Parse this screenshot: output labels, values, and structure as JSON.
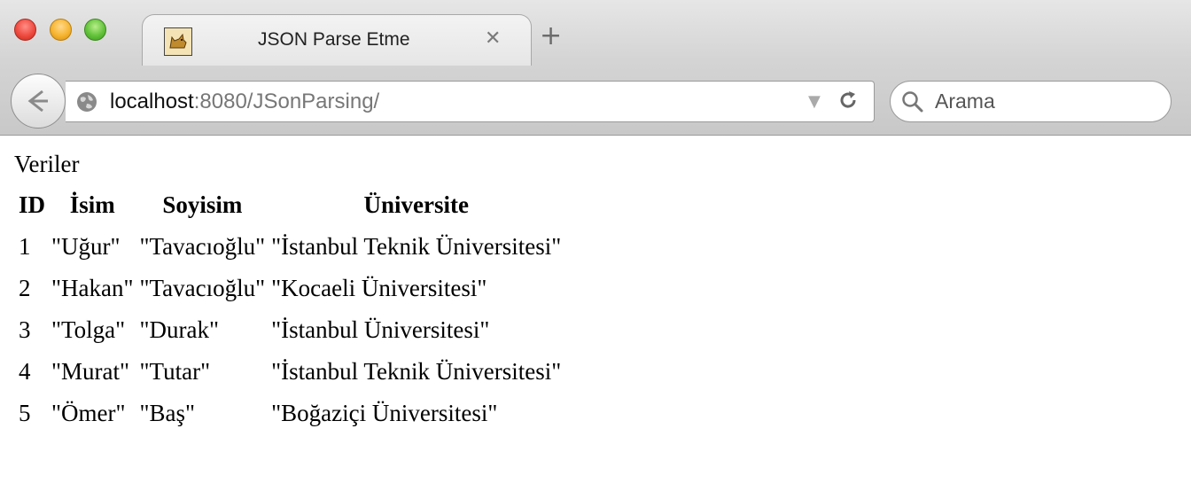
{
  "browser": {
    "tab_title": "JSON Parse Etme",
    "tab_close": "✕",
    "new_tab": "+",
    "url_host": "localhost",
    "url_rest": ":8080/JSonParsing/",
    "search_placeholder": "Arama"
  },
  "page": {
    "heading": "Veriler",
    "columns": [
      "ID",
      "İsim",
      "Soyisim",
      "Üniversite"
    ],
    "rows": [
      [
        "1",
        "\"Uğur\"",
        "\"Tavacıoğlu\"",
        "\"İstanbul Teknik Üniversitesi\""
      ],
      [
        "2",
        "\"Hakan\"",
        "\"Tavacıoğlu\"",
        "\"Kocaeli Üniversitesi\""
      ],
      [
        "3",
        "\"Tolga\"",
        "\"Durak\"",
        "\"İstanbul Üniversitesi\""
      ],
      [
        "4",
        "\"Murat\"",
        "\"Tutar\"",
        "\"İstanbul Teknik Üniversitesi\""
      ],
      [
        "5",
        "\"Ömer\"",
        "\"Baş\"",
        "\"Boğaziçi Üniversitesi\""
      ]
    ]
  }
}
